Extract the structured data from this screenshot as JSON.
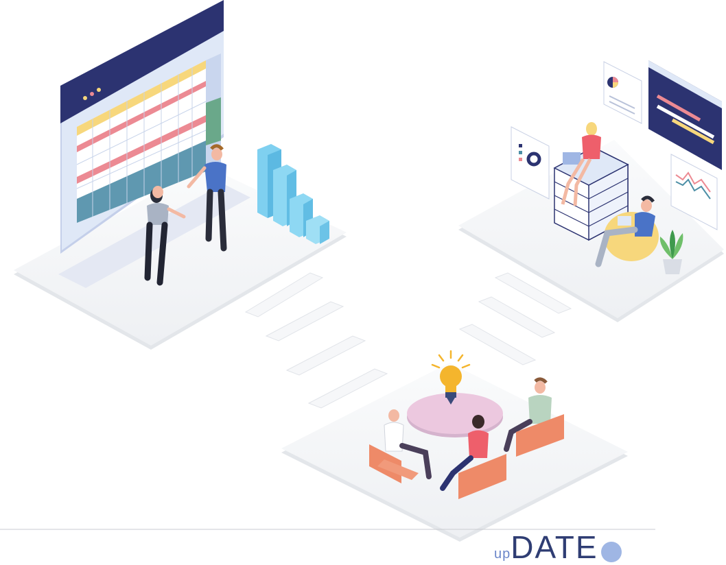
{
  "brand": {
    "prefix": "up",
    "main": "DATE"
  },
  "colors": {
    "board_frame": "#2c3371",
    "board_bg": "#dfe8f7",
    "accent_pink": "#ec8a93",
    "accent_yellow": "#f7d77c",
    "accent_teal": "#4d8fa6",
    "bar_blue": "#7fd0f0",
    "table_pink": "#ecc8df",
    "chair_orange": "#ee8a68",
    "bulb_yellow": "#f4b52d",
    "platform": "#f4f5f7",
    "divider": "#c9cbd0"
  },
  "icons": [
    "lightbulb-icon",
    "pie-chart-icon",
    "line-chart-icon",
    "donut-chart-icon",
    "plant-icon"
  ]
}
